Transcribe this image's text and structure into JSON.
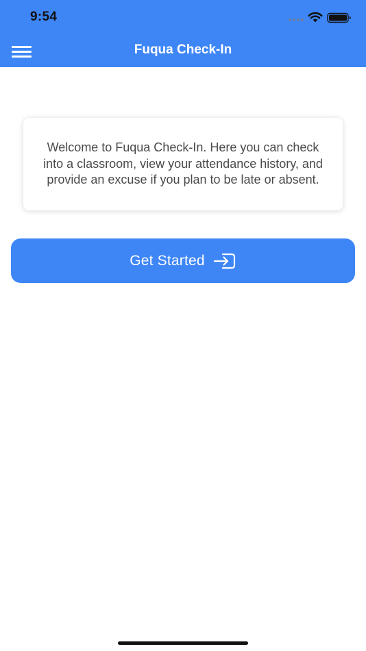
{
  "status_bar": {
    "time": "9:54"
  },
  "nav_bar": {
    "title": "Fuqua Check-In",
    "menu_icon": "hamburger-menu-icon"
  },
  "welcome_card": {
    "text": "Welcome to Fuqua Check-In. Here you can check into a classroom, view your attendance history, and provide an excuse if you plan to be late or absent."
  },
  "get_started_button": {
    "label": "Get Started",
    "icon": "sign-in-icon"
  },
  "colors": {
    "accent": "#3e86f6",
    "background": "#ffffff",
    "body_text": "#4a4a4a"
  }
}
